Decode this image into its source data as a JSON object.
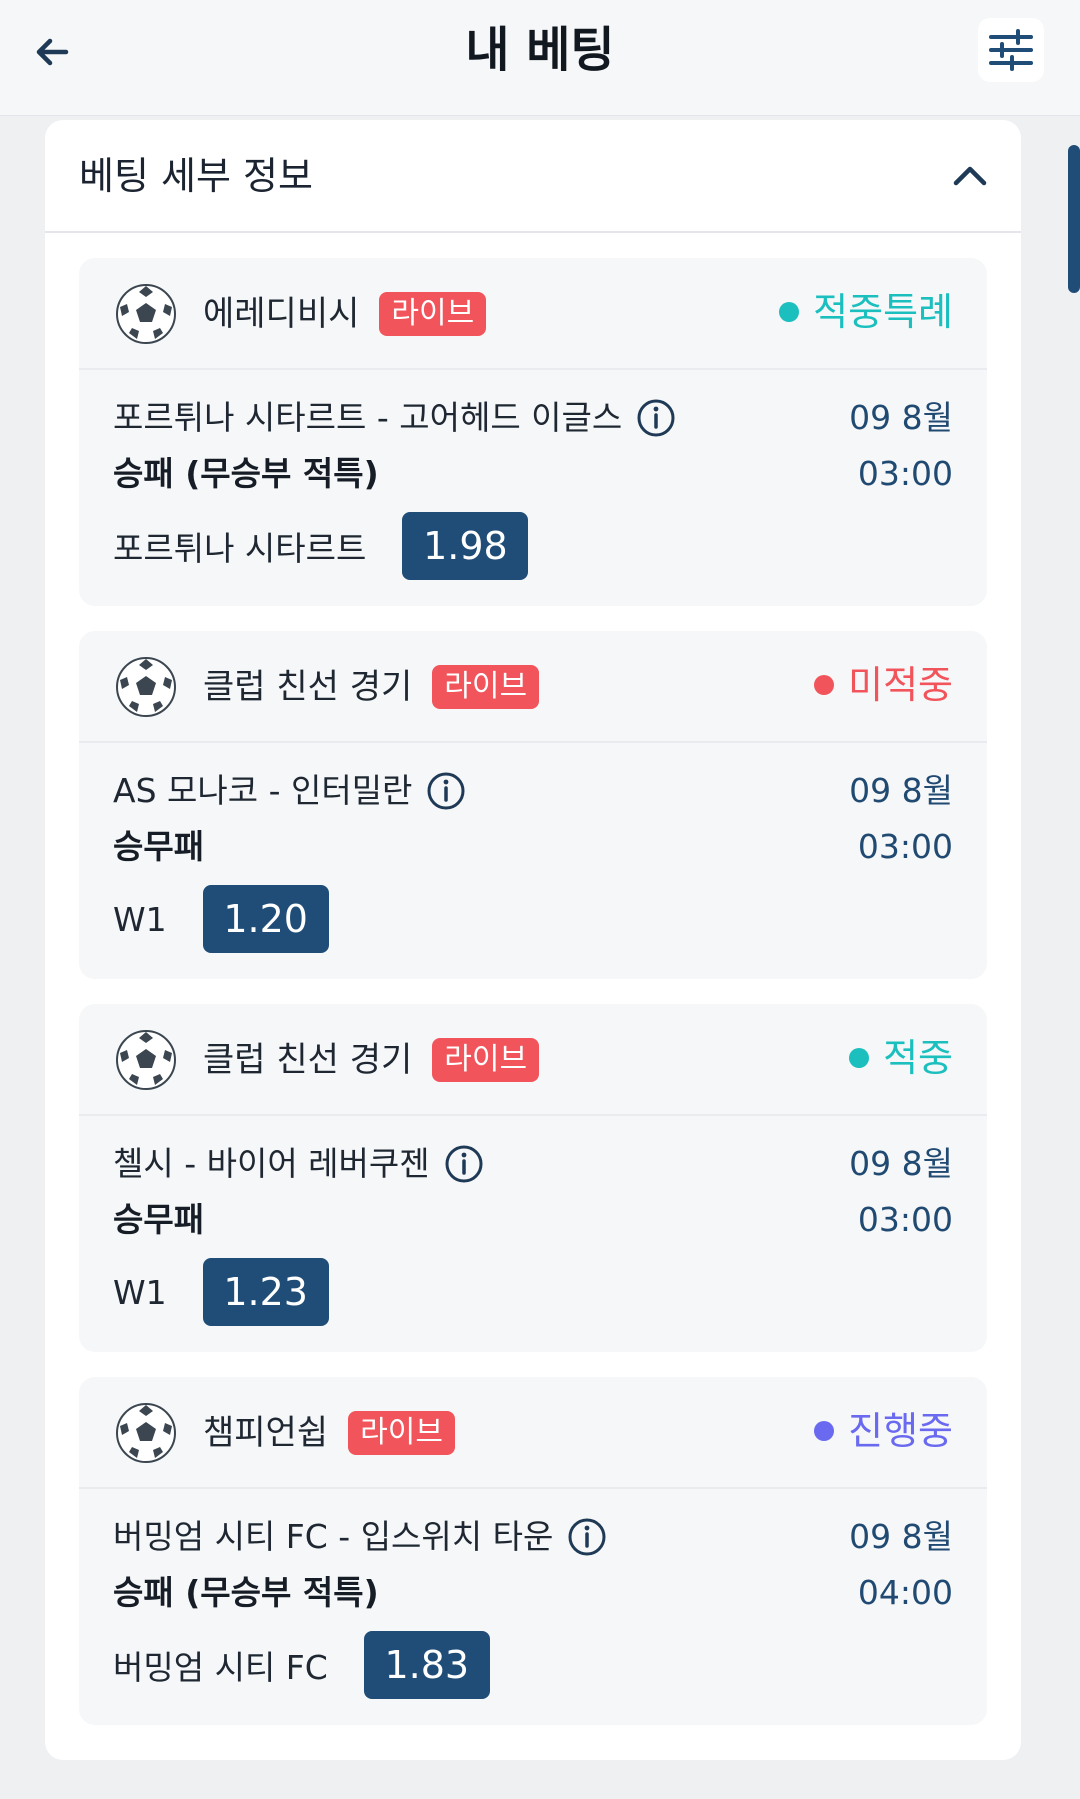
{
  "header": {
    "title": "내 베팅"
  },
  "panel": {
    "title": "베팅 세부 정보"
  },
  "bets": [
    {
      "league": "에레디비시",
      "live_label": "라이브",
      "status": "적중특례",
      "status_color": "#1bbfbe",
      "match": "포르튀나 시타르트 - 고어헤드 이글스",
      "market": "승패 (무승부 적특)",
      "pick": "포르튀나 시타르트",
      "odds": "1.98",
      "date": "09 8월",
      "time": "03:00"
    },
    {
      "league": "클럽 친선 경기",
      "live_label": "라이브",
      "status": "미적중",
      "status_color": "#f2545b",
      "match": "AS 모나코 - 인터밀란",
      "market": "승무패",
      "pick": "W1",
      "odds": "1.20",
      "date": "09 8월",
      "time": "03:00"
    },
    {
      "league": "클럽 친선 경기",
      "live_label": "라이브",
      "status": "적중",
      "status_color": "#1bbfbe",
      "match": "첼시 - 바이어 레버쿠젠",
      "market": "승무패",
      "pick": "W1",
      "odds": "1.23",
      "date": "09 8월",
      "time": "03:00"
    },
    {
      "league": "챔피언쉽",
      "live_label": "라이브",
      "status": "진행중",
      "status_color": "#6a6af0",
      "match": "버밍엄 시티 FC - 입스위치 타운",
      "market": "승패 (무승부 적특)",
      "pick": "버밍엄 시티 FC",
      "odds": "1.83",
      "date": "09 8월",
      "time": "04:00"
    }
  ]
}
